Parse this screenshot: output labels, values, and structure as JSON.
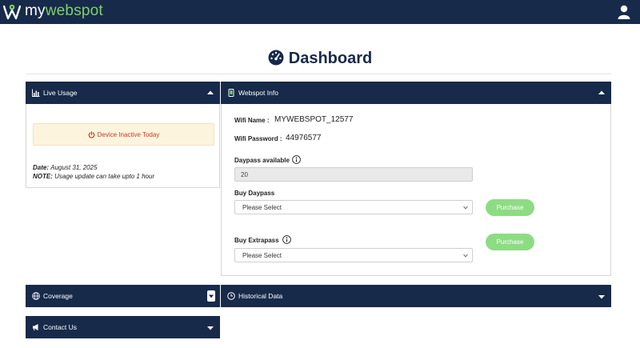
{
  "brand": {
    "name_a": "my",
    "name_b": "webspot"
  },
  "title": "Dashboard",
  "live_usage": {
    "heading": "Live Usage",
    "status": "Device Inactive Today",
    "date_label": "Date:",
    "date_value": "August 31, 2025",
    "note_label": "NOTE:",
    "note_value": "Usage update can take upto 1 hour"
  },
  "webspot_info": {
    "heading": "Webspot Info",
    "wifi_name_label": "Wifi Name :",
    "wifi_name": "MYWEBSPOT_12577",
    "wifi_password_label": "Wifi Password :",
    "wifi_password": "44976577",
    "daypass_available_label": "Daypass available",
    "daypass_available": "20",
    "buy_daypass_label": "Buy Daypass",
    "buy_daypass_selected": "Please Select",
    "buy_extrapass_label": "Buy Extrapass",
    "buy_extrapass_selected": "Please Select",
    "purchase_label": "Purchase"
  },
  "coverage": {
    "heading": "Coverage"
  },
  "historical": {
    "heading": "Historical Data"
  },
  "contact": {
    "heading": "Contact Us"
  },
  "colors": {
    "navy": "#172a4a",
    "accent_green": "#7ed16a",
    "button_green": "#8ddc83",
    "inactive_red": "#c43a2b",
    "inactive_bg": "#fdf4de"
  },
  "icons": [
    "logo-icon",
    "user-icon",
    "dashboard-icon",
    "chart-icon",
    "phone-icon",
    "power-icon",
    "info-icon",
    "globe-icon",
    "clock-icon",
    "megaphone-icon",
    "chevron-up-icon",
    "chevron-down-icon"
  ]
}
